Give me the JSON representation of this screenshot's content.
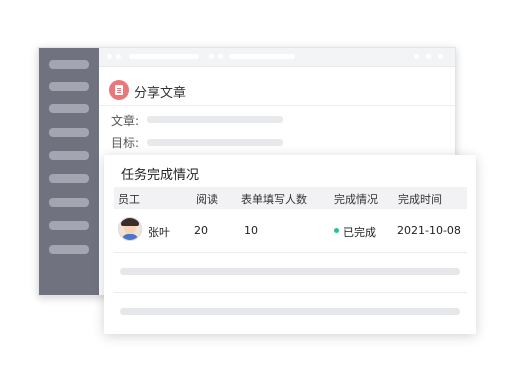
{
  "share": {
    "title": "分享文章"
  },
  "fields": [
    {
      "label": "文章:"
    },
    {
      "label": "目标:"
    }
  ],
  "card": {
    "title": "任务完成情况",
    "columns": [
      "员工",
      "阅读",
      "表单填写人数",
      "完成情况",
      "完成时间"
    ],
    "rows": [
      {
        "name": "张叶",
        "reads": "20",
        "form_count": "10",
        "status": "已完成",
        "time": "2021-10-08"
      }
    ]
  },
  "colors": {
    "accent": "#e8787a",
    "status_done": "#2cc38a",
    "sidebar": "#70727f"
  },
  "icons": {
    "share": "document-icon",
    "avatar": "avatar"
  }
}
